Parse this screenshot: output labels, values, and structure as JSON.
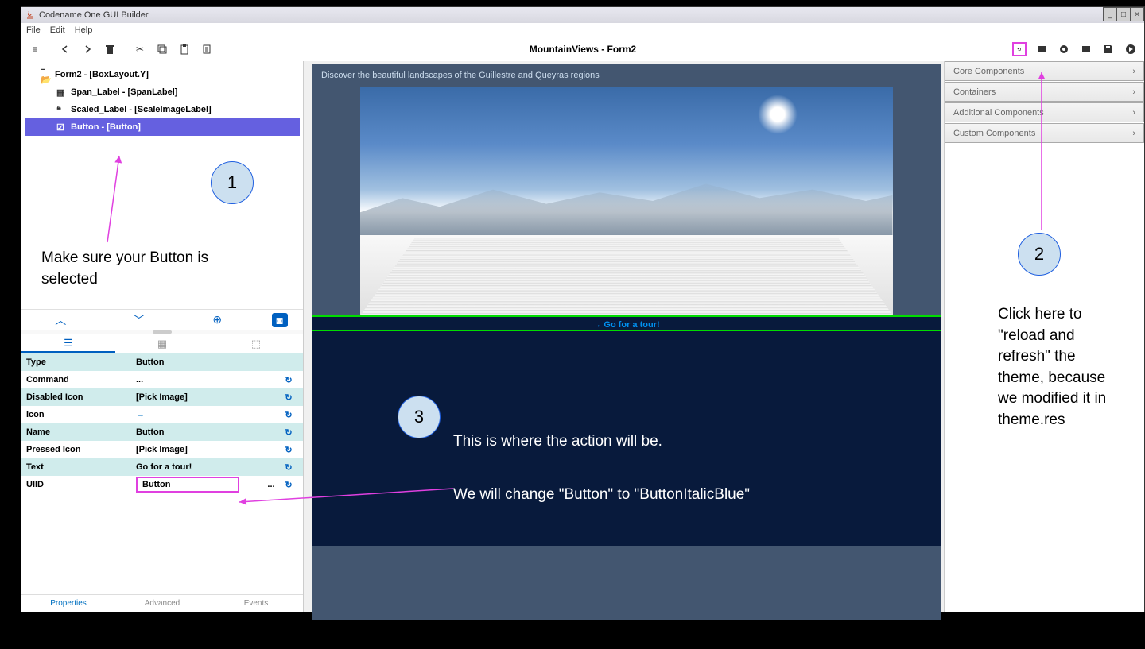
{
  "window": {
    "title": "Codename One GUI Builder"
  },
  "menubar": {
    "file": "File",
    "edit": "Edit",
    "help": "Help"
  },
  "toolbar": {
    "center_title": "MountainViews - Form2"
  },
  "tree": {
    "root": "Form2 - [BoxLayout.Y]",
    "items": [
      {
        "label": "Span_Label - [SpanLabel]"
      },
      {
        "label": "Scaled_Label - [ScaleImageLabel]"
      },
      {
        "label": "Button - [Button]"
      }
    ]
  },
  "canvas": {
    "heading": "Discover the beautiful landscapes of the Guillestre and Queyras regions",
    "button_text": "→  Go for a tour!"
  },
  "right": {
    "sections": [
      "Core Components",
      "Containers",
      "Additional Components",
      "Custom Components"
    ]
  },
  "properties": {
    "rows": [
      {
        "label": "Type",
        "value": "Button"
      },
      {
        "label": "Command",
        "value": "..."
      },
      {
        "label": "Disabled Icon",
        "value": "[Pick Image]"
      },
      {
        "label": "Icon",
        "value": "→"
      },
      {
        "label": "Name",
        "value": "Button"
      },
      {
        "label": "Pressed Icon",
        "value": "[Pick Image]"
      },
      {
        "label": "Text",
        "value": "Go for a tour!"
      },
      {
        "label": "UIID",
        "value": "Button"
      }
    ]
  },
  "bottom_tabs": {
    "properties": "Properties",
    "advanced": "Advanced",
    "events": "Events"
  },
  "annotations": {
    "n1": "1",
    "n2": "2",
    "n3": "3",
    "text1": "Make sure your Button is selected",
    "text2": "Click here to \"reload and refresh\" the theme, because we modified it in theme.res",
    "text3a": "This is where the action will be.",
    "text3b": "We will change \"Button\" to \"ButtonItalicBlue\""
  }
}
